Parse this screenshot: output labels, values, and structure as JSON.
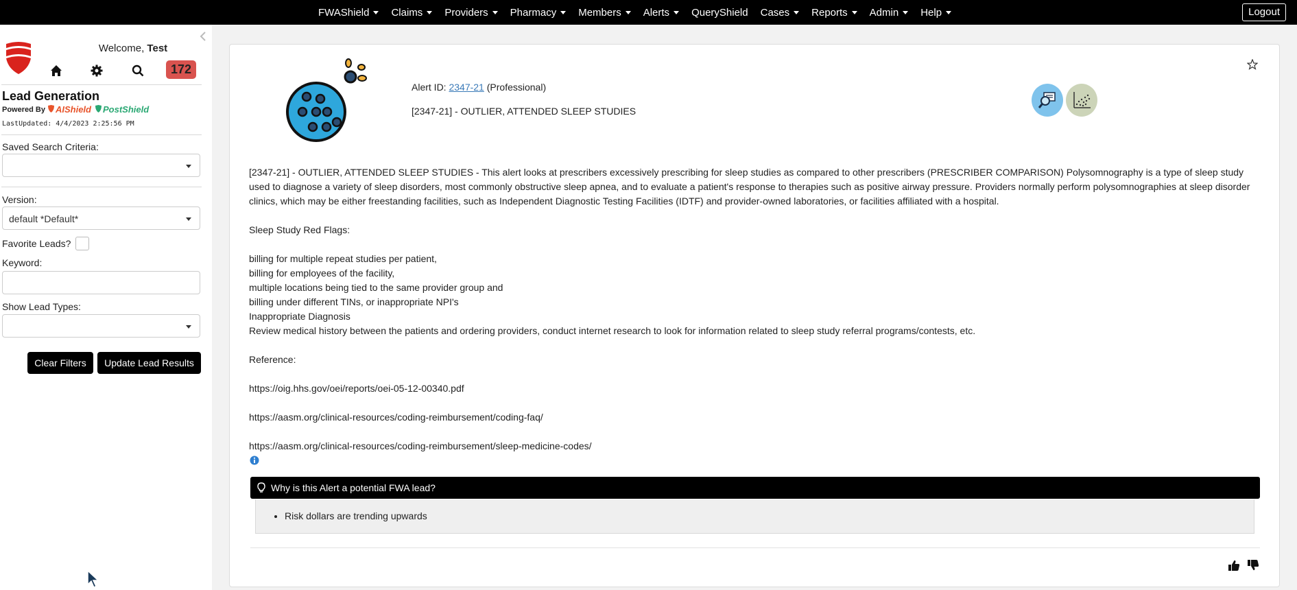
{
  "nav": {
    "items": [
      {
        "label": "FWAShield",
        "dropdown": true
      },
      {
        "label": "Claims",
        "dropdown": true
      },
      {
        "label": "Providers",
        "dropdown": true
      },
      {
        "label": "Pharmacy",
        "dropdown": true
      },
      {
        "label": "Members",
        "dropdown": true
      },
      {
        "label": "Alerts",
        "dropdown": true
      },
      {
        "label": "QueryShield",
        "dropdown": false
      },
      {
        "label": "Cases",
        "dropdown": true
      },
      {
        "label": "Reports",
        "dropdown": true
      },
      {
        "label": "Admin",
        "dropdown": true
      },
      {
        "label": "Help",
        "dropdown": true
      }
    ],
    "logout_label": "Logout"
  },
  "sidebar": {
    "welcome_prefix": "Welcome,",
    "user_name": "Test",
    "alert_count": "172",
    "title": "Lead Generation",
    "powered_by": "Powered By",
    "brand_ai": "AIShield",
    "brand_post": "PostShield",
    "last_updated": "LastUpdated: 4/4/2023 2:25:56 PM",
    "saved_search_label": "Saved Search Criteria:",
    "saved_search_value": "",
    "version_label": "Version:",
    "version_value": "default *Default*",
    "favorite_label": "Favorite Leads?",
    "keyword_label": "Keyword:",
    "keyword_value": "",
    "lead_types_label": "Show Lead Types:",
    "lead_types_value": "",
    "clear_label": "Clear Filters",
    "update_label": "Update Lead Results"
  },
  "alert": {
    "id_prefix": "Alert ID:",
    "id": "2347-21",
    "type": "(Professional)",
    "title": "[2347-21] - OUTLIER, ATTENDED SLEEP STUDIES",
    "description": "[2347-21] - OUTLIER, ATTENDED SLEEP STUDIES - This alert looks at prescribers excessively prescribing for sleep studies as compared to other prescribers (PRESCRIBER COMPARISON) Polysomnography is a type of sleep study used to diagnose a variety of sleep disorders, most commonly obstructive sleep apnea, and to evaluate a patient's response to therapies such as positive airway pressure. Providers normally perform polysomnographies at sleep disorder clinics, which may be either freestanding facilities, such as Independent Diagnostic Testing Facilities (IDTF) and provider-owned laboratories, or facilities affiliated with a hospital.",
    "red_flags_heading": "Sleep Study Red Flags:",
    "red_flags": [
      "billing for multiple repeat studies per patient,",
      "billing for employees of the facility,",
      "multiple locations being tied to the same provider group and",
      "billing under different TINs, or inappropriate NPI's",
      "Inappropriate Diagnosis",
      "Review medical history between the patients and ordering providers, conduct internet research to look for information related to sleep study referral programs/contests, etc."
    ],
    "reference_heading": "Reference:",
    "references": [
      "https://oig.hhs.gov/oei/reports/oei-05-12-00340.pdf",
      "https://aasm.org/clinical-resources/coding-reimbursement/coding-faq/",
      "https://aasm.org/clinical-resources/coding-reimbursement/sleep-medicine-codes/"
    ],
    "why_heading": "Why is this Alert a potential FWA lead?",
    "reasons": [
      "Risk dollars are trending upwards"
    ]
  },
  "colors": {
    "nav_bg": "#000000",
    "badge": "#d9534f",
    "link": "#3a7ab8",
    "zoom_circle": "#7fc3ec",
    "scatter_circle": "#ccd4b8",
    "ai_brand": "#e8542b",
    "post_brand": "#2aa873"
  },
  "icons": [
    "home-icon",
    "gear-icon",
    "search-icon",
    "collapse-left-icon",
    "star-icon",
    "magnifier-report-icon",
    "scatter-plot-icon",
    "info-icon",
    "lightbulb-icon",
    "thumbs-up-icon",
    "thumbs-down-icon"
  ]
}
